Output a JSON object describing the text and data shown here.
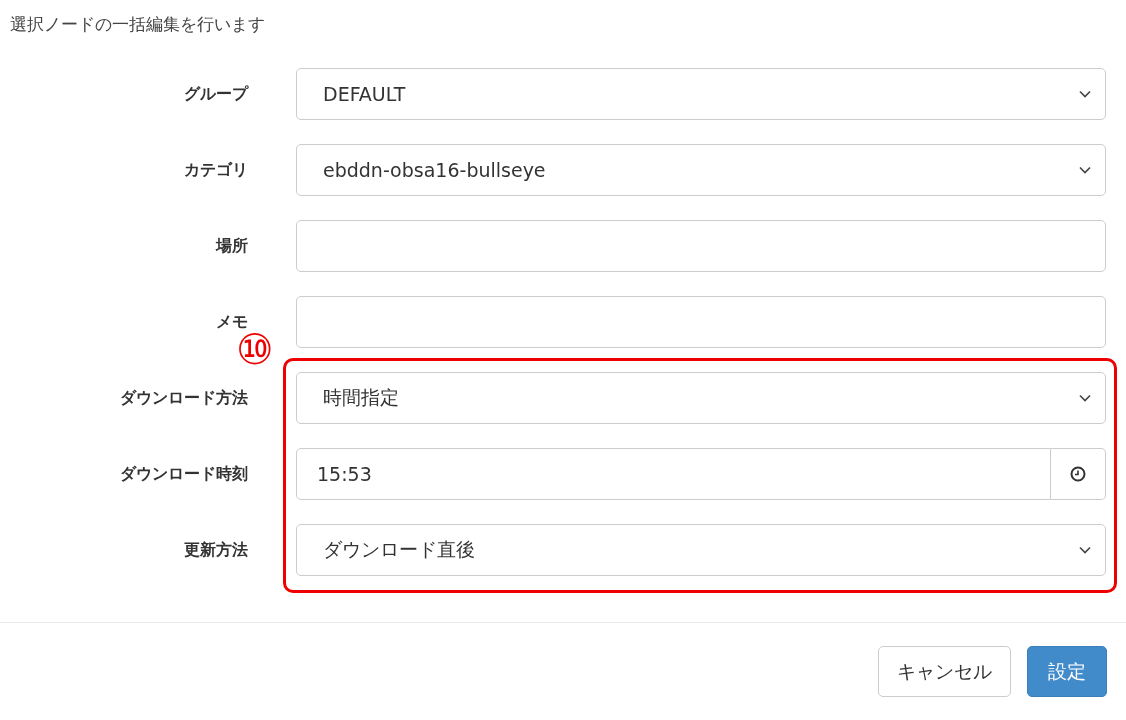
{
  "intro": "選択ノードの一括編集を行います",
  "annotation": "⑩",
  "fields": [
    {
      "label": "グループ",
      "kind": "select",
      "value": "DEFAULT",
      "highlighted": false
    },
    {
      "label": "カテゴリ",
      "kind": "select",
      "value": "ebddn-obsa16-bullseye",
      "highlighted": false
    },
    {
      "label": "場所",
      "kind": "text",
      "highlighted": false
    },
    {
      "label": "メモ",
      "kind": "text",
      "highlighted": false
    },
    {
      "label": "ダウンロード方法",
      "kind": "select",
      "value": "時間指定",
      "highlighted": true
    },
    {
      "label": "ダウンロード時刻",
      "kind": "time",
      "value": "15:53",
      "highlighted": true
    },
    {
      "label": "更新方法",
      "kind": "select",
      "value": "ダウンロード直後",
      "highlighted": true
    }
  ],
  "buttons": [
    {
      "label": "キャンセル",
      "kind": "secondary"
    },
    {
      "label": "設定",
      "kind": "primary"
    }
  ]
}
